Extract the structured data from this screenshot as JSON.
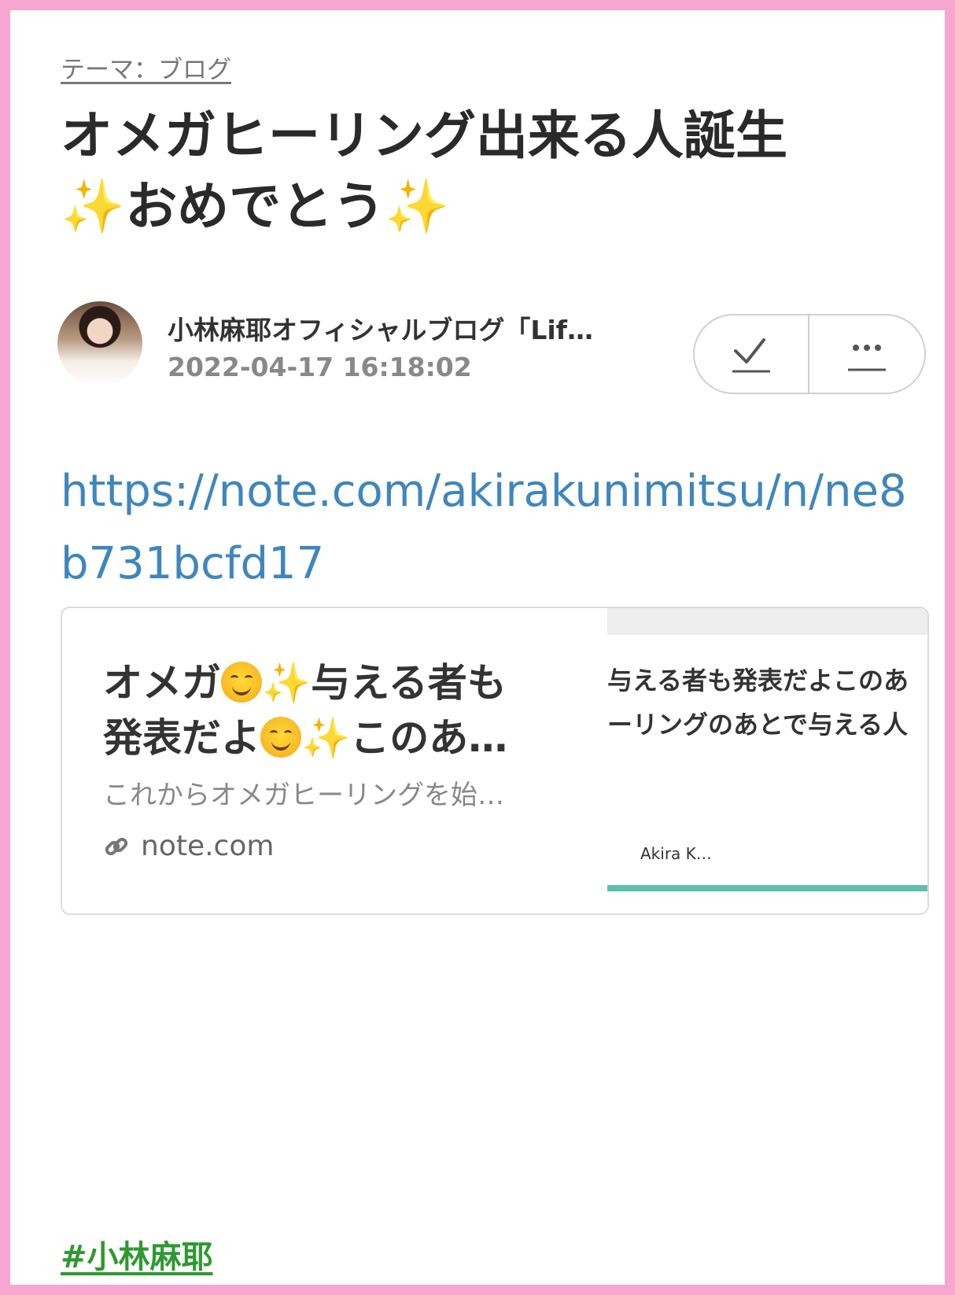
{
  "theme": {
    "label": "テーマ：ブログ"
  },
  "post": {
    "title_line1": "オメガヒーリング出来る人誕生",
    "sparkle": "✨",
    "title_line2": "おめでとう",
    "blog_name": "小林麻耶オフィシャルブログ「Lif…",
    "date": "2022-04-17 16:18:02",
    "url": "https://note.com/akirakunimitsu/n/ne8b731bcfd17"
  },
  "actions": {
    "check_icon": "check-icon",
    "more_icon": "more-icon"
  },
  "card": {
    "title_a": "オメガ",
    "title_b": "与える者も",
    "title_c": "発表だよ",
    "title_d": "このあ…",
    "sparkle": "✨",
    "description": "これからオメガヒーリングを始…",
    "domain": "note.com",
    "thumb_line1": "与える者も発表だよこのあ",
    "thumb_line2": "ーリングのあとで与える人",
    "thumb_author": "Akira K…",
    "thumb_bar_color": "#5fbfad"
  },
  "hashtag": "#小林麻耶",
  "colors": {
    "frame": "#f7a6cf",
    "link": "#3f86bd",
    "hashtag": "#2e9930"
  }
}
